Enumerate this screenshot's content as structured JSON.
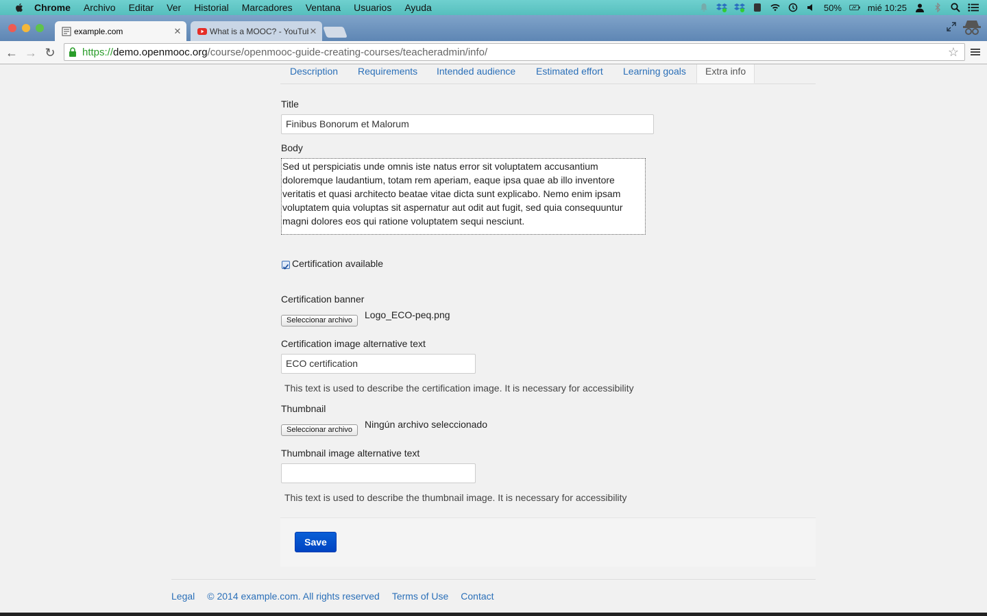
{
  "menubar": {
    "app": "Chrome",
    "items": [
      "Archivo",
      "Editar",
      "Ver",
      "Historial",
      "Marcadores",
      "Ventana",
      "Usuarios",
      "Ayuda"
    ],
    "battery": "50%",
    "clock": "mié 10:25"
  },
  "browser": {
    "tabs": [
      {
        "title": "example.com",
        "active": true
      },
      {
        "title": "What is a MOOC? - YouTube",
        "active": false
      }
    ],
    "url": {
      "scheme": "https://",
      "host": "demo.openmooc.org",
      "path": "/course/openmooc-guide-creating-courses/teacheradmin/info/"
    }
  },
  "form_tabs": [
    "Description",
    "Requirements",
    "Intended audience",
    "Estimated effort",
    "Learning goals",
    "Extra info"
  ],
  "active_form_tab": "Extra info",
  "form": {
    "title_label": "Title",
    "title_value": "Finibus Bonorum et Malorum",
    "body_label": "Body",
    "body_value": "Sed ut perspiciatis unde omnis iste natus error sit voluptatem accusantium doloremque laudantium, totam rem aperiam, eaque ipsa quae ab illo inventore veritatis et quasi architecto beatae vitae dicta sunt explicabo. Nemo enim ipsam voluptatem quia voluptas sit aspernatur aut odit aut fugit, sed quia consequuntur magni dolores eos qui ratione voluptatem sequi nesciunt.",
    "certification_label": "Certification available",
    "certification_checked": true,
    "banner_label": "Certification banner",
    "banner_button": "Seleccionar archivo",
    "banner_file": "Logo_ECO-peq.png",
    "cert_alt_label": "Certification image alternative text",
    "cert_alt_value": "ECO certification",
    "cert_alt_help": "This text is used to describe the certification image. It is necessary for accessibility",
    "thumb_label": "Thumbnail",
    "thumb_button": "Seleccionar archivo",
    "thumb_file": "Ningún archivo seleccionado",
    "thumb_alt_label": "Thumbnail image alternative text",
    "thumb_alt_value": "",
    "thumb_alt_help": "This text is used to describe the thumbnail image. It is necessary for accessibility",
    "save_label": "Save"
  },
  "footer": {
    "legal": "Legal",
    "copyright": "© 2014 example.com. All rights reserved",
    "terms": "Terms of Use",
    "contact": "Contact"
  },
  "colors": {
    "menubar": "#5ec5c3",
    "link": "#2a6fb8",
    "save_button": "#0a55d0"
  }
}
